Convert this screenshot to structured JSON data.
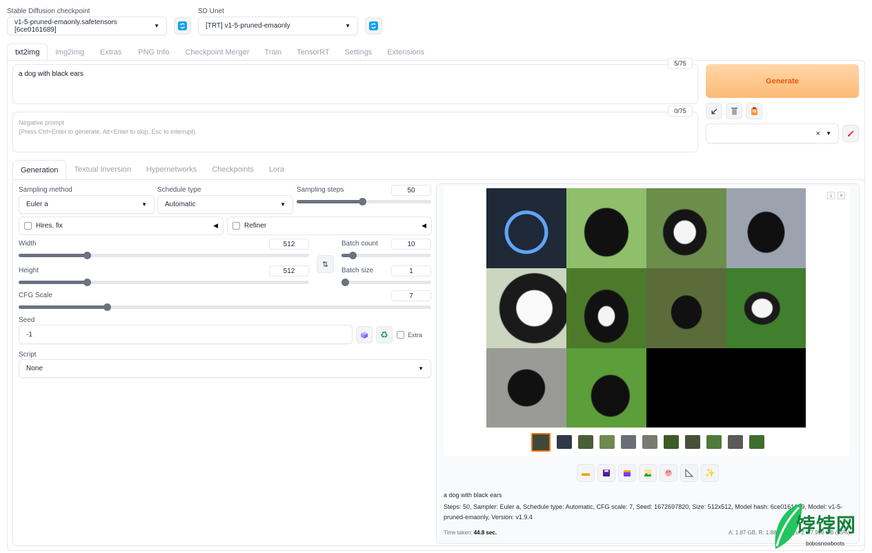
{
  "checkpoint": {
    "label": "Stable Diffusion checkpoint",
    "value": "v1-5-pruned-emaonly.safetensors [6ce0161689]"
  },
  "unet": {
    "label": "SD Unet",
    "value": "[TRT] v1-5-pruned-emaonly"
  },
  "main_tabs": [
    "txt2img",
    "img2img",
    "Extras",
    "PNG Info",
    "Checkpoint Merger",
    "Train",
    "TensorRT",
    "Settings",
    "Extensions"
  ],
  "prompt": {
    "value": "a dog with black ears",
    "counter": "5/75"
  },
  "negative_prompt": {
    "placeholder_line1": "Negative prompt",
    "placeholder_line2": "(Press Ctrl+Enter to generate, Alt+Enter to skip, Esc to interrupt)",
    "counter": "0/75"
  },
  "generate_label": "Generate",
  "sub_tabs": [
    "Generation",
    "Textual Inversion",
    "Hypernetworks",
    "Checkpoints",
    "Lora"
  ],
  "sampling_method": {
    "label": "Sampling method",
    "value": "Euler a"
  },
  "schedule_type": {
    "label": "Schedule type",
    "value": "Automatic"
  },
  "sampling_steps": {
    "label": "Sampling steps",
    "value": "50",
    "fraction": 0.49
  },
  "hires_fix": "Hires. fix",
  "refiner": "Refiner",
  "width": {
    "label": "Width",
    "value": "512",
    "fraction": 0.23
  },
  "height": {
    "label": "Height",
    "value": "512",
    "fraction": 0.23
  },
  "batch_count": {
    "label": "Batch count",
    "value": "10",
    "fraction": 0.09
  },
  "batch_size": {
    "label": "Batch size",
    "value": "1",
    "fraction": 0.0
  },
  "cfg_scale": {
    "label": "CFG Scale",
    "value": "7",
    "fraction": 0.21
  },
  "seed": {
    "label": "Seed",
    "value": "-1",
    "extra_label": "Extra"
  },
  "script": {
    "label": "Script",
    "value": "None"
  },
  "output": {
    "caption": "a dog with black ears",
    "params": "Steps: 50, Sampler: Euler a, Schedule type: Automatic, CFG scale: 7, Seed: 1672697820, Size: 512x512, Model hash: 6ce0161689, Model: v1-5-pruned-emaonly, Version: v1.9.4",
    "time_label": "Time taken:",
    "time_value": "44.8 sec.",
    "vram": "A: 1.87 GB, R: 1.88 GB, Sys: 2.8/7.996 GB (35%)"
  },
  "watermark": {
    "name": "饽饽网",
    "url": "bobosnowboots"
  },
  "colors": {
    "accent": "#f97316",
    "generate_bg": "#fdba74",
    "generate_text": "#ea580c"
  },
  "icons": [
    "refresh-icon",
    "arrow-icon",
    "trash-icon",
    "clipboard-icon",
    "pencil-icon",
    "swap-icon",
    "dice-icon",
    "recycle-icon",
    "folder-icon",
    "save-icon",
    "zip-icon",
    "image-icon",
    "palette-icon",
    "ruler-icon",
    "sparkle-icon"
  ]
}
